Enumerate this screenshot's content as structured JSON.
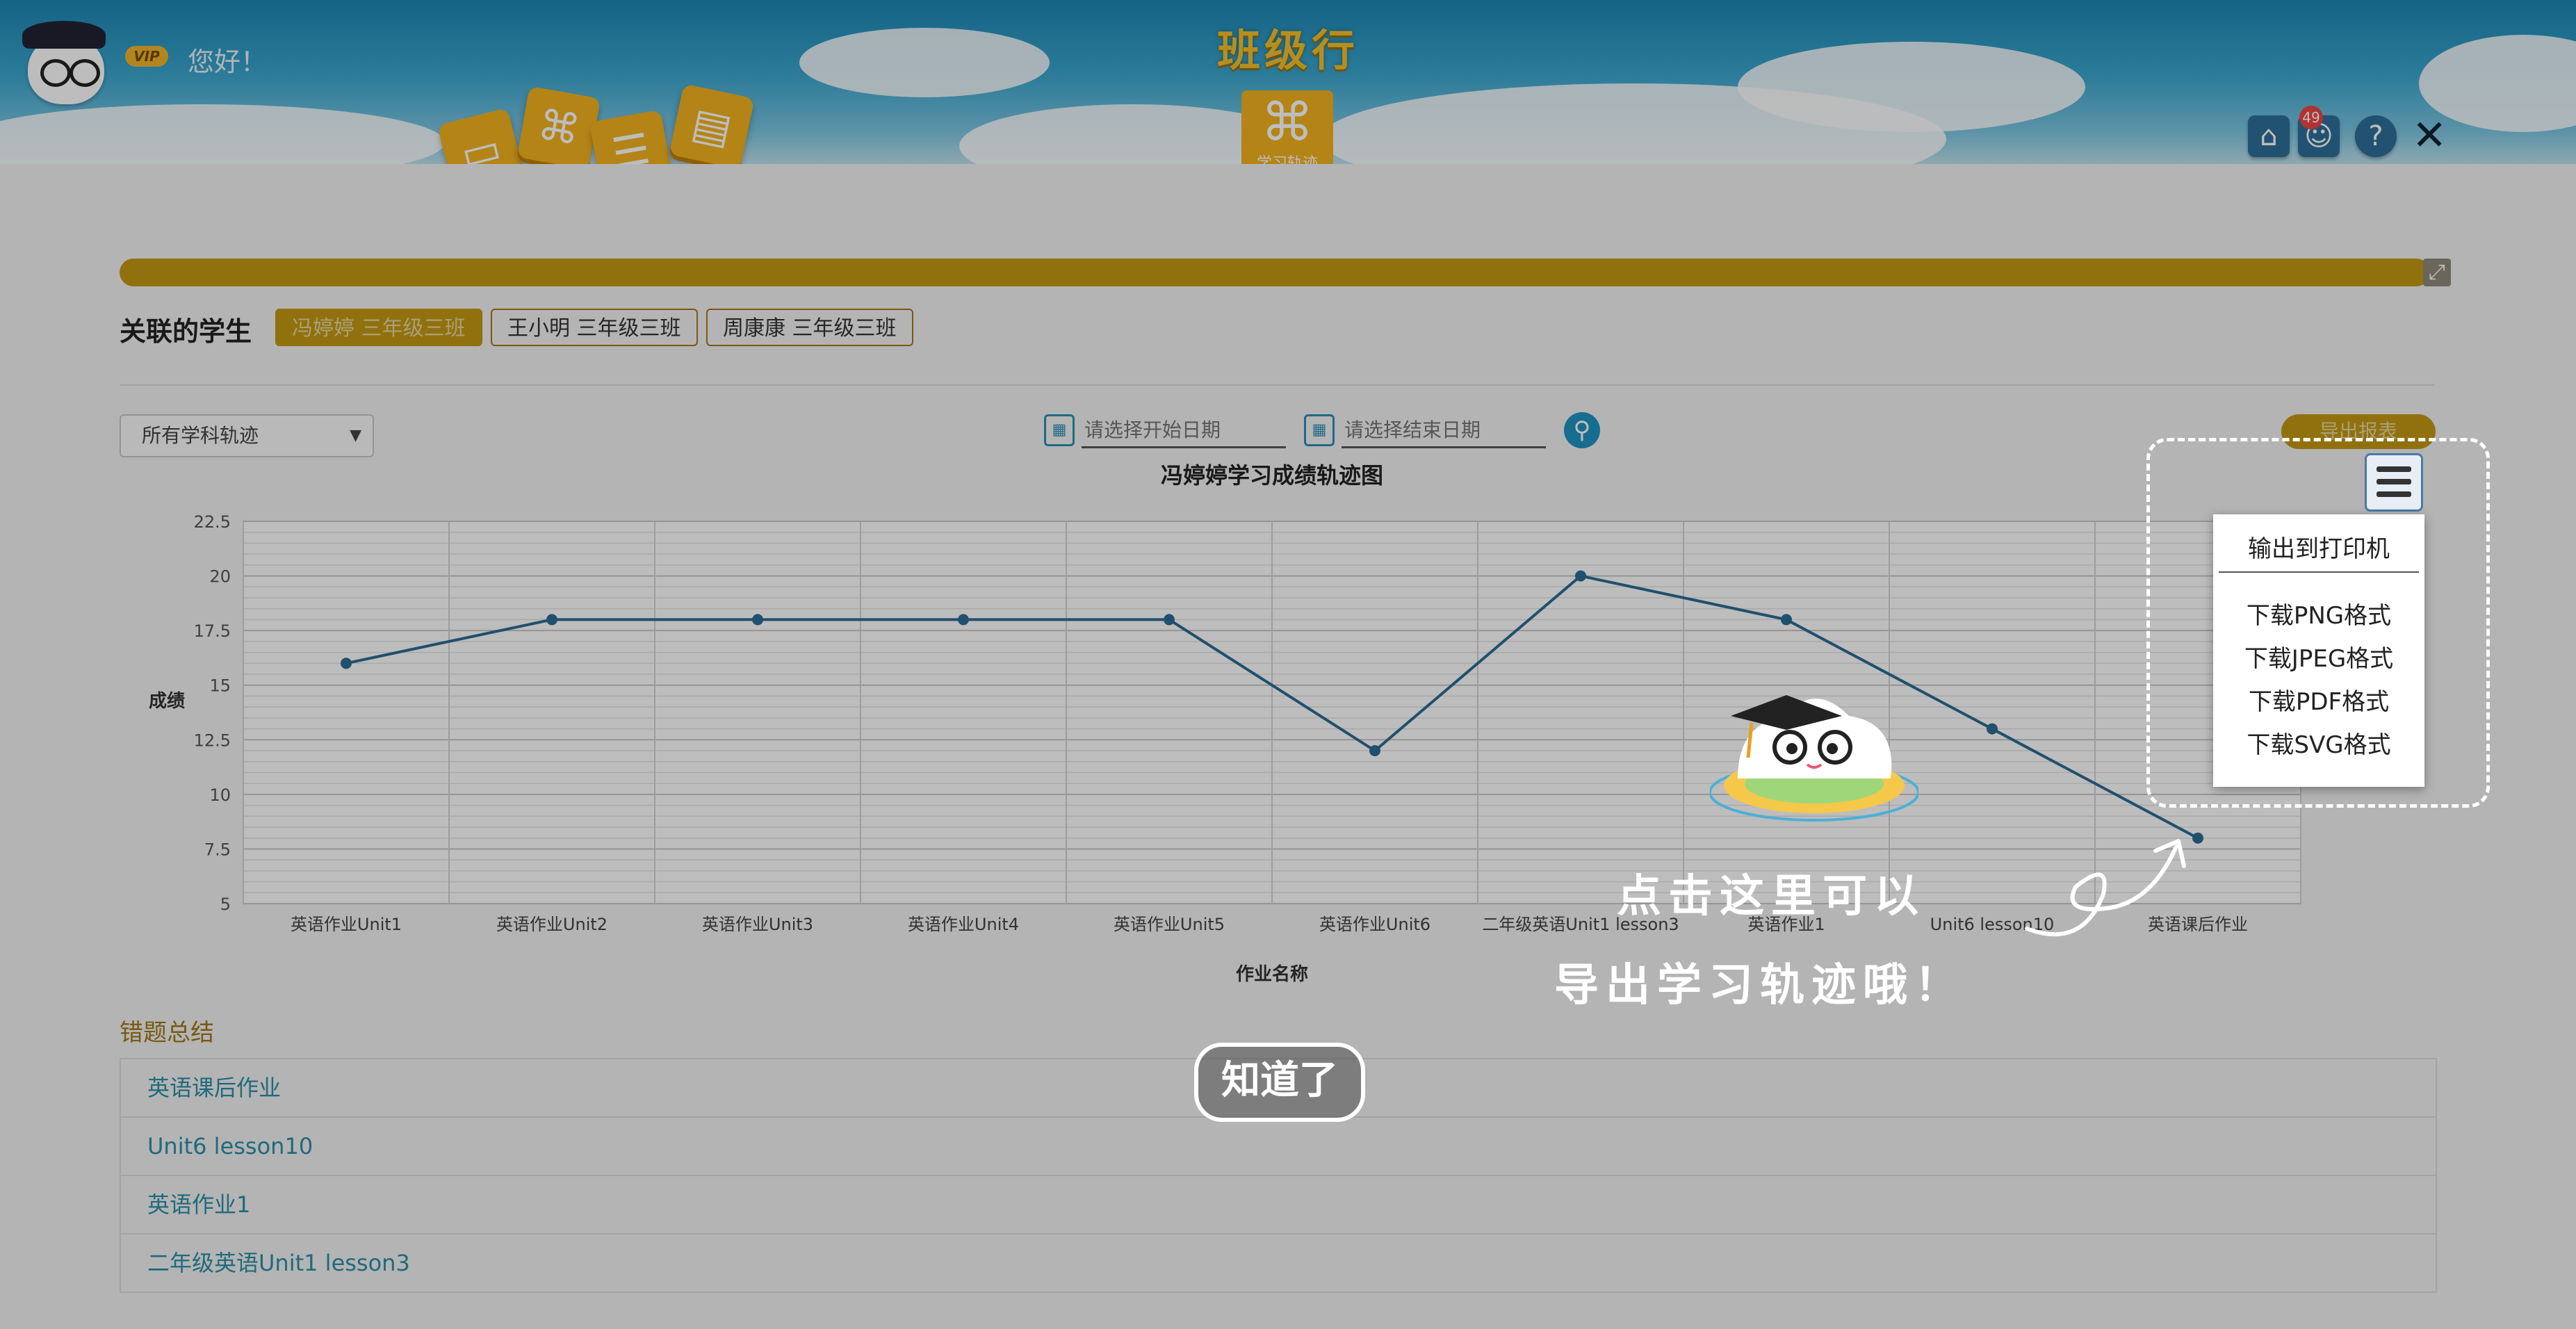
{
  "header": {
    "greeting": "您好！",
    "vip": "VIP",
    "app_title": "班级行",
    "center_tile_label": "学习轨迹",
    "message_count": "49"
  },
  "related": {
    "label": "关联的学生",
    "students": [
      "冯婷婷 三年级三班",
      "王小明 三年级三班",
      "周康康 三年级三班"
    ]
  },
  "filters": {
    "subject_select": "所有学科轨迹",
    "start_placeholder": "请选择开始日期",
    "end_placeholder": "请选择结束日期",
    "export_label": "导出报表"
  },
  "chart_data": {
    "type": "line",
    "title": "冯婷婷学习成绩轨迹图",
    "xlabel": "作业名称",
    "ylabel": "成绩",
    "ylim": [
      5,
      22.5
    ],
    "yticks": [
      "22.5",
      "20",
      "17.5",
      "15",
      "12.5",
      "10",
      "7.5",
      "5"
    ],
    "categories": [
      "英语作业Unit1",
      "英语作业Unit2",
      "英语作业Unit3",
      "英语作业Unit4",
      "英语作业Unit5",
      "英语作业Unit6",
      "二年级英语Unit1 lesson3",
      "英语作业1",
      "Unit6 lesson10",
      "英语课后作业"
    ],
    "values": [
      16,
      18,
      18,
      18,
      18,
      12,
      20,
      18,
      13,
      8
    ],
    "line_color": "#2c6d93",
    "grid": true
  },
  "export_menu": {
    "print": "输出到打印机",
    "png": "下载PNG格式",
    "jpeg": "下载JPEG格式",
    "pdf": "下载PDF格式",
    "svg": "下载SVG格式"
  },
  "errors": {
    "title": "错题总结",
    "items": [
      "英语课后作业",
      "Unit6 lesson10",
      "英语作业1",
      "二年级英语Unit1 lesson3"
    ]
  },
  "guide": {
    "line1": "点击这里可以",
    "line2": "导出学习轨迹哦！",
    "ok": "知道了"
  }
}
